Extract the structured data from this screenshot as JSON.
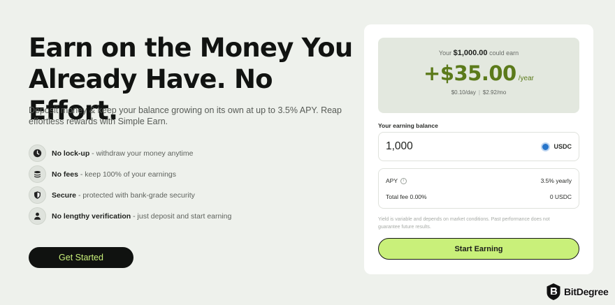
{
  "hero": {
    "title": "Earn on the Money You Already Have. No Effort.",
    "subtitle": "Deposit money & keep your balance growing on its own at up to 3.5% APY. Reap effortless rewards with Simple Earn."
  },
  "features": [
    {
      "icon": "clock-icon",
      "title": "No lock-up",
      "desc": " - withdraw your money anytime"
    },
    {
      "icon": "coins-icon",
      "title": "No fees",
      "desc": " - keep 100% of your earnings"
    },
    {
      "icon": "shield-icon",
      "title": "Secure",
      "desc": " - protected with bank-grade security"
    },
    {
      "icon": "user-icon",
      "title": "No lengthy verification",
      "desc": " - just deposit and start earning"
    }
  ],
  "cta": {
    "get_started": "Get Started"
  },
  "calculator": {
    "summary_prefix": "Your",
    "summary_amount": "$1,000.00",
    "summary_suffix": "could earn",
    "earn_value": "+$35.00",
    "earn_unit": "/year",
    "per_day": "$0.10/day",
    "per_month": "$2.92/mo",
    "balance_label": "Your earning balance",
    "balance_value": "1,000",
    "currency": "USDC",
    "apy_label": "APY",
    "apy_value": "3.5% yearly",
    "fee_label": "Total fee 0.00%",
    "fee_value": "0 USDC",
    "disclaimer": "Yield is variable and depends on market conditions. Past performance does not guarantee future results.",
    "start_button": "Start Earning"
  },
  "watermark": {
    "text": "BitDegree"
  },
  "colors": {
    "background": "#eef1ec",
    "accent_lime": "#c9f07a",
    "earn_green": "#5b7a1a",
    "dark": "#101210",
    "usdc_blue": "#2775ca"
  }
}
